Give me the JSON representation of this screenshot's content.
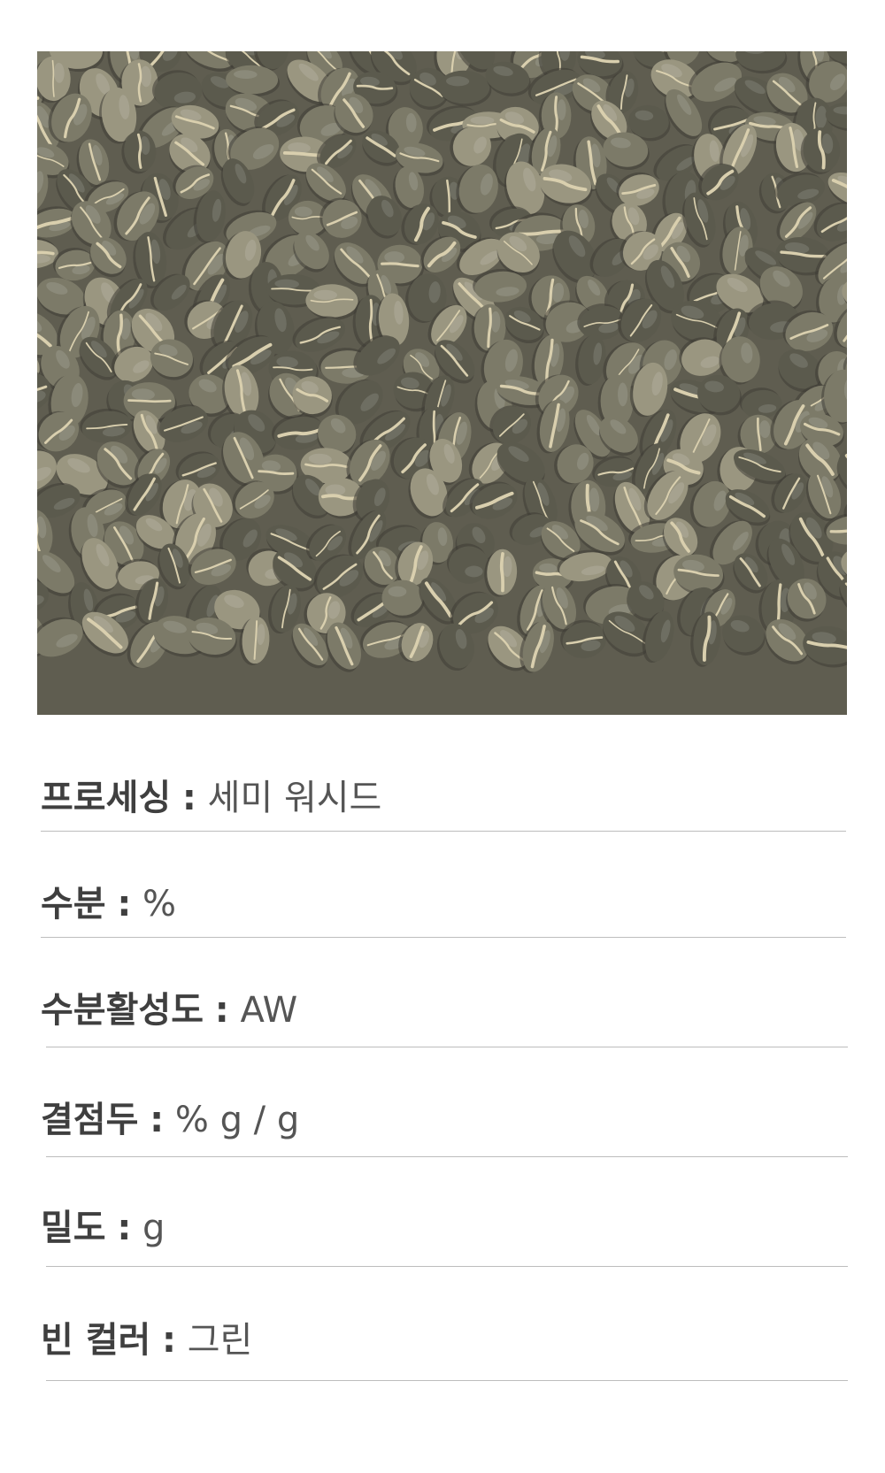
{
  "photo": {
    "subject": "green-coffee-beans-photo",
    "colors": {
      "background": "#6d6a5c",
      "bean_dark": "#5b5a4d",
      "bean_mid": "#7c7a68",
      "bean_light": "#9a9680",
      "silverskin": "#d9cfae"
    }
  },
  "specs": [
    {
      "label": "프로세싱",
      "separator": ":",
      "value": "세미 워시드"
    },
    {
      "label": "수분",
      "separator": ":",
      "value": "%"
    },
    {
      "label": "수분활성도",
      "separator": ":",
      "value": "AW"
    },
    {
      "label": "결점두",
      "separator": ":",
      "value": "% g / g"
    },
    {
      "label": "밀도",
      "separator": ":",
      "value": "g"
    },
    {
      "label": "빈 컬러",
      "separator": ":",
      "value": "그린"
    }
  ],
  "colors": {
    "label": "#3f3f3f",
    "value": "#555555",
    "divider": "#bdbdbd"
  }
}
